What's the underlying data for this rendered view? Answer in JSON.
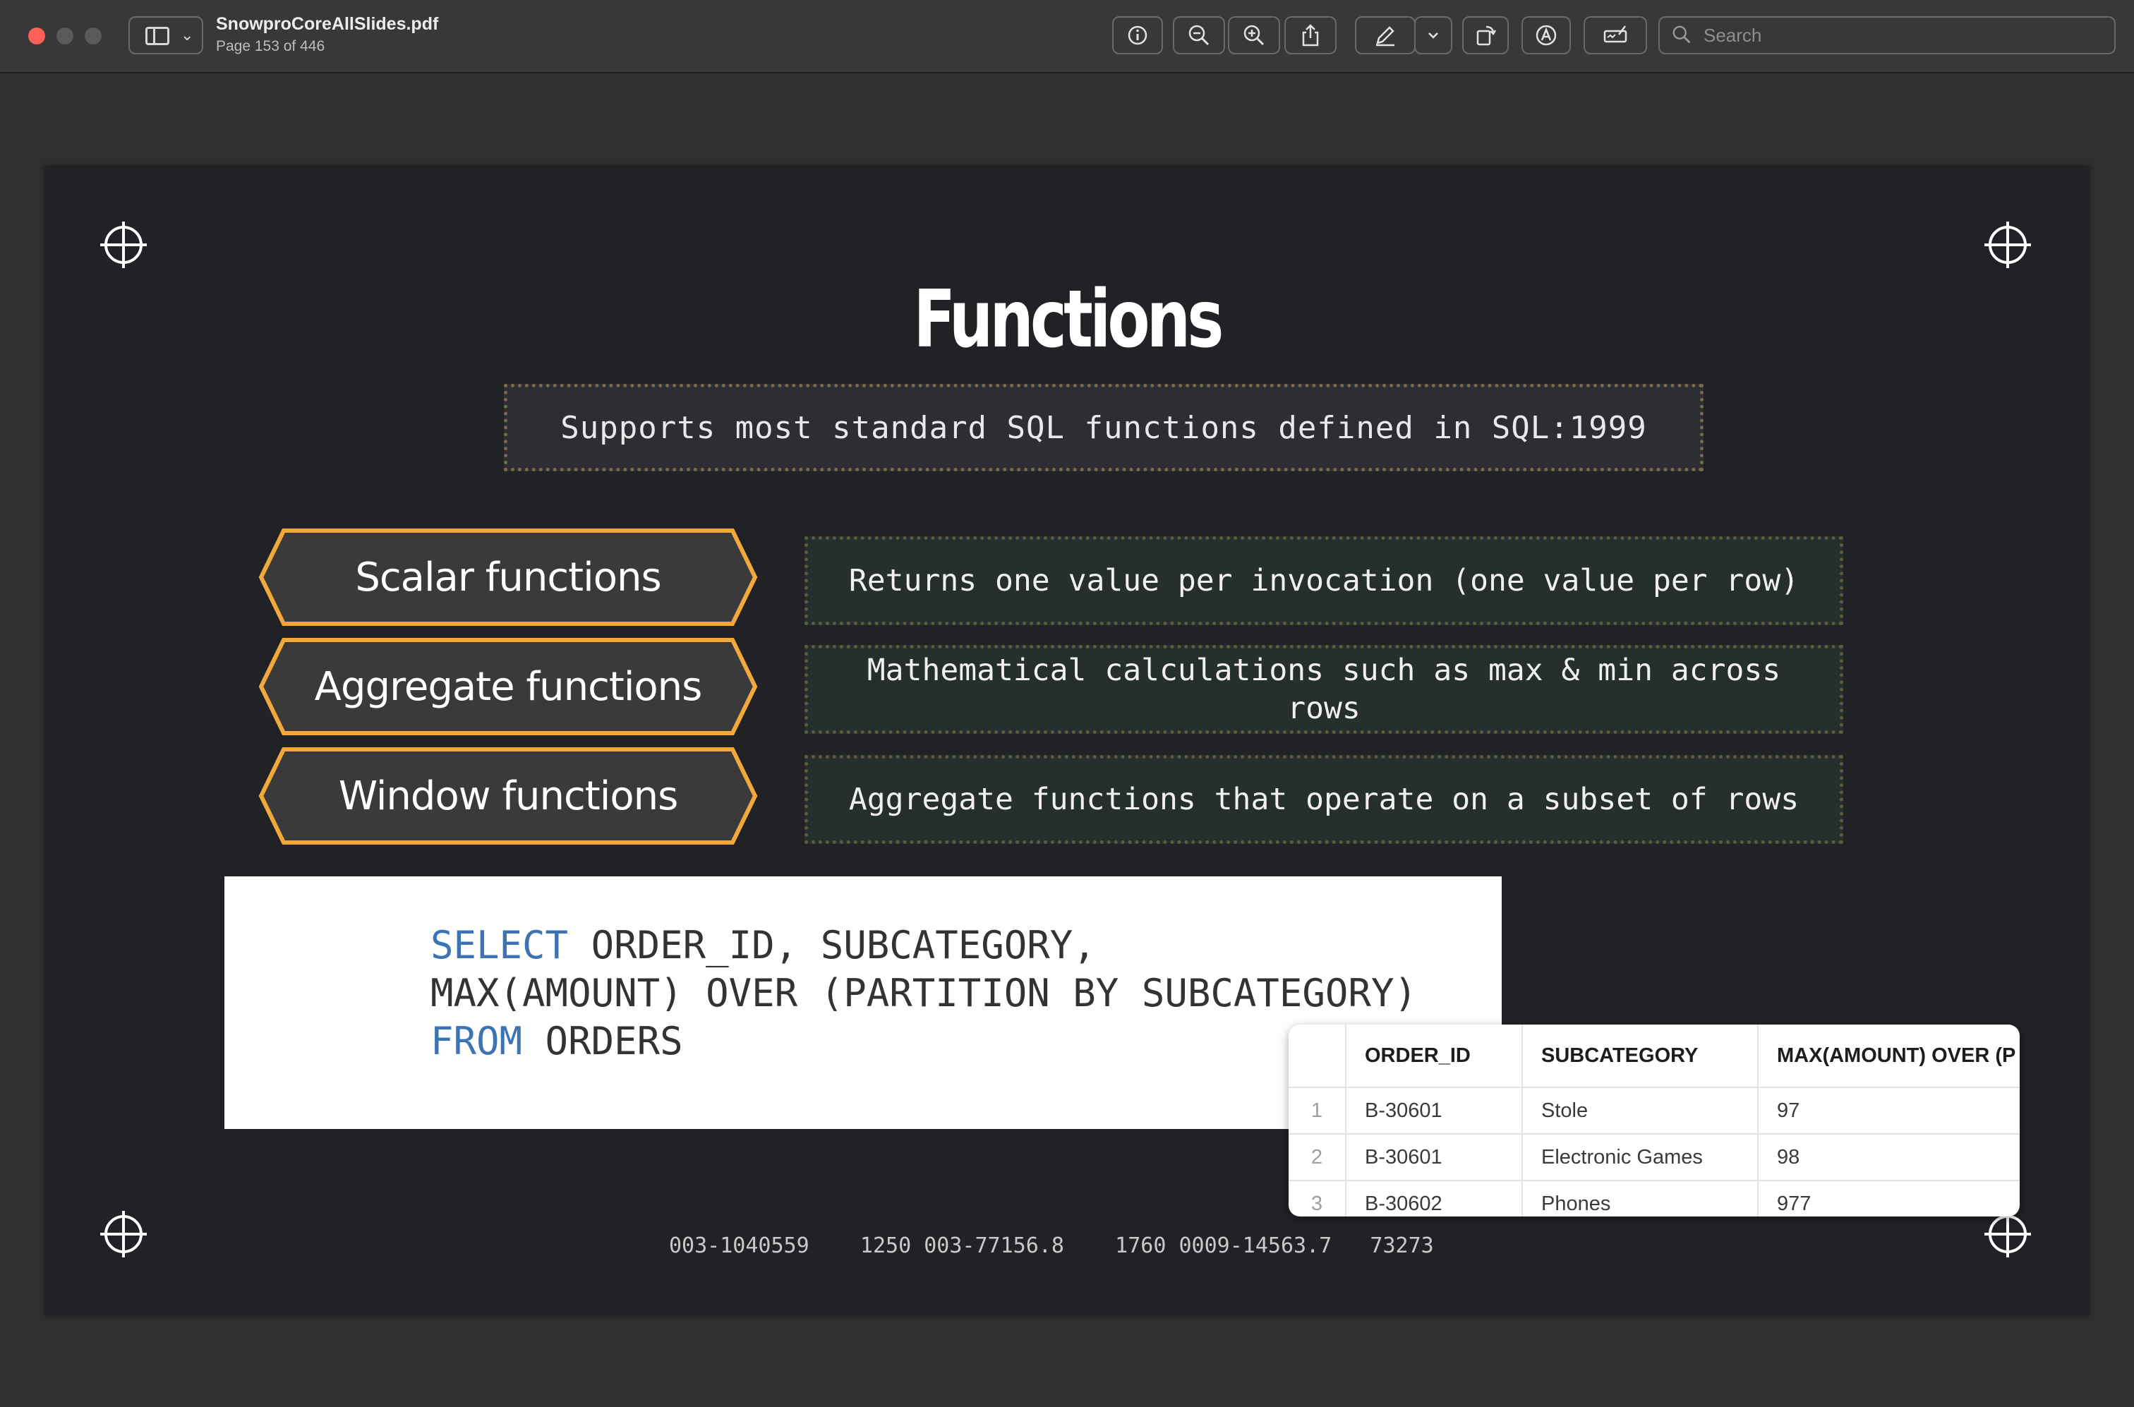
{
  "window": {
    "title": "SnowproCoreAllSlides.pdf",
    "page_info": "Page 153 of 446",
    "search_placeholder": "Search"
  },
  "toolbar_icons": [
    "info-icon",
    "zoom-out-icon",
    "zoom-in-icon",
    "share-icon",
    "markup-pen-icon",
    "chevron-down-icon",
    "rotate-icon",
    "highlight-icon",
    "sign-icon",
    "search-icon"
  ],
  "slide": {
    "title": "Functions",
    "subtitle": "Supports most standard SQL functions defined in SQL:1999",
    "function_types": [
      {
        "label": "Scalar functions",
        "description": "Returns one value per invocation (one value per row)"
      },
      {
        "label": "Aggregate functions",
        "description": "Mathematical calculations such as max & min across rows"
      },
      {
        "label": "Window functions",
        "description": "Aggregate functions that operate on a subset of rows"
      }
    ],
    "code": {
      "line1_kw": "SELECT",
      "line1_rest": " ORDER_ID, SUBCATEGORY,",
      "line2": "MAX(AMOUNT) OVER (PARTITION BY SUBCATEGORY)",
      "line3_kw": "FROM",
      "line3_rest": " ORDERS"
    },
    "footer_numbers": "003-1040559    1250 003-77156.8    1760 0009-14563.7   73273"
  },
  "results": {
    "columns": [
      "",
      "ORDER_ID",
      "SUBCATEGORY",
      "MAX(AMOUNT) OVER (P"
    ],
    "rows": [
      {
        "n": "1",
        "order_id": "B-30601",
        "subcategory": "Stole",
        "max": "97"
      },
      {
        "n": "2",
        "order_id": "B-30601",
        "subcategory": "Electronic Games",
        "max": "98"
      },
      {
        "n": "3",
        "order_id": "B-30602",
        "subcategory": "Phones",
        "max": "977"
      }
    ]
  },
  "colors": {
    "hex_border": "#f3a83b",
    "keyword_blue": "#3b73b3",
    "close_red": "#fe5f57"
  }
}
